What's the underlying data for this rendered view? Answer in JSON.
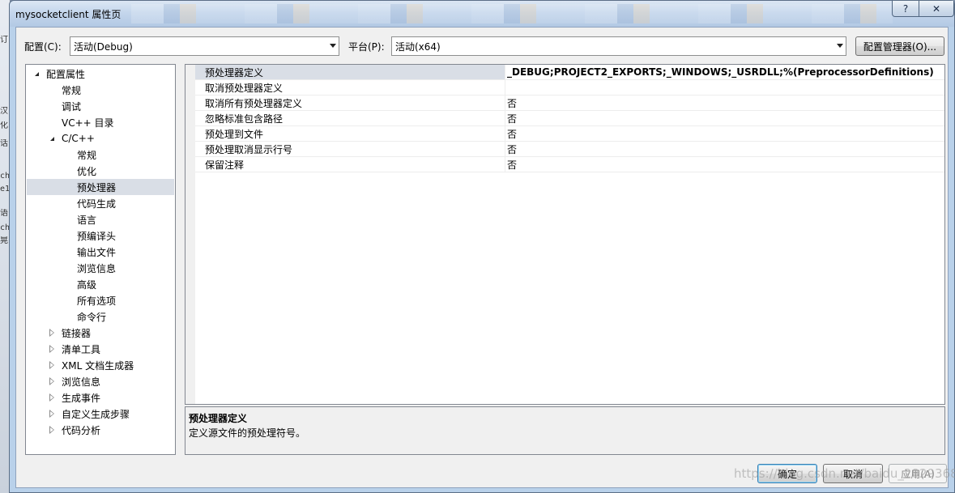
{
  "window": {
    "title": "mysocketclient 属性页",
    "help_glyph": "?",
    "close_glyph": "✕"
  },
  "desktop_chars": [
    "订",
    "汉",
    "化",
    "话",
    "ch",
    "e1",
    "语",
    "ch",
    "晃"
  ],
  "toolbar": {
    "config_label": "配置(C):",
    "config_value": "活动(Debug)",
    "platform_label": "平台(P):",
    "platform_value": "活动(x64)",
    "config_manager_label": "配置管理器(O)..."
  },
  "tree": {
    "items": [
      {
        "label": "配置属性",
        "expander": "open"
      },
      {
        "label": "常规",
        "expander": "none"
      },
      {
        "label": "调试",
        "expander": "none"
      },
      {
        "label": "VC++ 目录",
        "expander": "none"
      },
      {
        "label": "C/C++",
        "expander": "open"
      },
      {
        "label": "常规",
        "expander": "none"
      },
      {
        "label": "优化",
        "expander": "none"
      },
      {
        "label": "预处理器",
        "expander": "none",
        "selected": true
      },
      {
        "label": "代码生成",
        "expander": "none"
      },
      {
        "label": "语言",
        "expander": "none"
      },
      {
        "label": "预编译头",
        "expander": "none"
      },
      {
        "label": "输出文件",
        "expander": "none"
      },
      {
        "label": "浏览信息",
        "expander": "none"
      },
      {
        "label": "高级",
        "expander": "none"
      },
      {
        "label": "所有选项",
        "expander": "none"
      },
      {
        "label": "命令行",
        "expander": "none"
      },
      {
        "label": "链接器",
        "expander": "closed"
      },
      {
        "label": "清单工具",
        "expander": "closed"
      },
      {
        "label": "XML 文档生成器",
        "expander": "closed"
      },
      {
        "label": "浏览信息",
        "expander": "closed"
      },
      {
        "label": "生成事件",
        "expander": "closed"
      },
      {
        "label": "自定义生成步骤",
        "expander": "closed"
      },
      {
        "label": "代码分析",
        "expander": "closed"
      }
    ]
  },
  "grid": {
    "rows": [
      {
        "name": "预处理器定义",
        "value": "_DEBUG;PROJECT2_EXPORTS;_WINDOWS;_USRDLL;%(PreprocessorDefinitions)",
        "bold": true,
        "selected": true
      },
      {
        "name": "取消预处理器定义",
        "value": ""
      },
      {
        "name": "取消所有预处理器定义",
        "value": "否"
      },
      {
        "name": "忽略标准包含路径",
        "value": "否"
      },
      {
        "name": "预处理到文件",
        "value": "否"
      },
      {
        "name": "预处理取消显示行号",
        "value": "否"
      },
      {
        "name": "保留注释",
        "value": "否"
      }
    ]
  },
  "description": {
    "title": "预处理器定义",
    "text": "定义源文件的预处理符号。"
  },
  "buttons": {
    "ok": "确定",
    "cancel": "取消",
    "apply": "应用(A)"
  },
  "watermark": "https://blog.csdn.net/baidu_28293683"
}
